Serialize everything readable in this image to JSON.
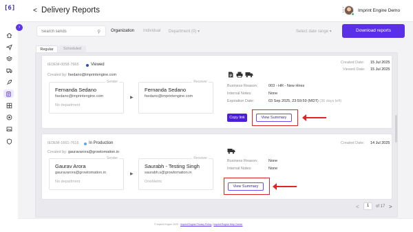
{
  "app": {
    "logo": "[6]"
  },
  "sidebar": {
    "collapse_glyph": "›",
    "icons": [
      "home-icon",
      "send-icon",
      "layers-icon",
      "truck-icon",
      "rocket-icon",
      "clipboard-icon",
      "grid-icon",
      "target-icon",
      "image-icon",
      "shield-icon"
    ]
  },
  "header": {
    "back_glyph": "<",
    "title": "Delivery Reports",
    "kebab": "⋮",
    "org_name": "Imprint Engine Demo"
  },
  "toolbar": {
    "search_placeholder": "Search sends",
    "filters": [
      "Organization",
      "Individual",
      "Department (0) ▾"
    ],
    "date_range": "Select date range ▾",
    "download_label": "Download reports"
  },
  "tabs": [
    "Regular",
    "Scheduled"
  ],
  "cards": [
    {
      "id": "IEDEM-0058-7665",
      "status": "Viewed",
      "status_color": "#2b47d6",
      "created_by_label": "Created by:",
      "created_by": "fsedano@imprintengine.com",
      "sender": {
        "role": "Sender",
        "name": "Fernanda Sedano",
        "email": "fsedano@imprintengine.com",
        "dept": "No department"
      },
      "receiver": {
        "role": "Receiver",
        "name": "Fernanda Sedano",
        "email": "fsedano@imprintengine.com",
        "dept": ""
      },
      "channels": [
        "document-icon",
        "printer-icon",
        "truck-icon"
      ],
      "details": [
        {
          "label": "Business Reason:",
          "value": "003 - HR - New Hires",
          "extra": ""
        },
        {
          "label": "Internal Notes:",
          "value": "None",
          "extra": ""
        },
        {
          "label": "Expiration Date:",
          "value": "03 Sep 2025, 23:59:59 (MDT)",
          "extra": "(36 days left)"
        }
      ],
      "created_date_label": "Created Date:",
      "created_date": "15 Jul 2025",
      "viewed_date_label": "Viewed Date:",
      "viewed_date": "15 Jul 2025",
      "copy_label": "Copy link",
      "view_label": "View Summary"
    },
    {
      "id": "IEDEM-1661-7616",
      "status": "In Production",
      "status_color": "#5aa9e8",
      "created_by_label": "Created by:",
      "created_by": "gauravarora@growtomation.in",
      "sender": {
        "role": "Sender",
        "name": "Gaurav Arora",
        "email": "gauravarora@growtomation.in",
        "dept": "No department"
      },
      "receiver": {
        "role": "Receiver",
        "name": "Saurabh - Testing Singh",
        "email": "saurabh.s@growtomation.in",
        "dept": "OneMetric"
      },
      "channels": [
        "truck-icon"
      ],
      "details": [
        {
          "label": "Business Reason:",
          "value": "None",
          "extra": ""
        },
        {
          "label": "Internal Notes:",
          "value": "None",
          "extra": ""
        }
      ],
      "created_date_label": "Created Date:",
      "created_date": "14 Jul 2025",
      "view_label": "View Summary"
    }
  ],
  "pagination": {
    "prev": "<",
    "current": "1",
    "total": "of 17",
    "next": ">"
  },
  "footer": {
    "copyright": "© Imprint Engine 2025",
    "privacy_link": "Imprint Engine Privacy Policy",
    "sep": "|",
    "help_link": "Imprint Engine Help Center"
  },
  "colors": {
    "accent": "#5b2ee8",
    "highlight": "#e02424"
  }
}
